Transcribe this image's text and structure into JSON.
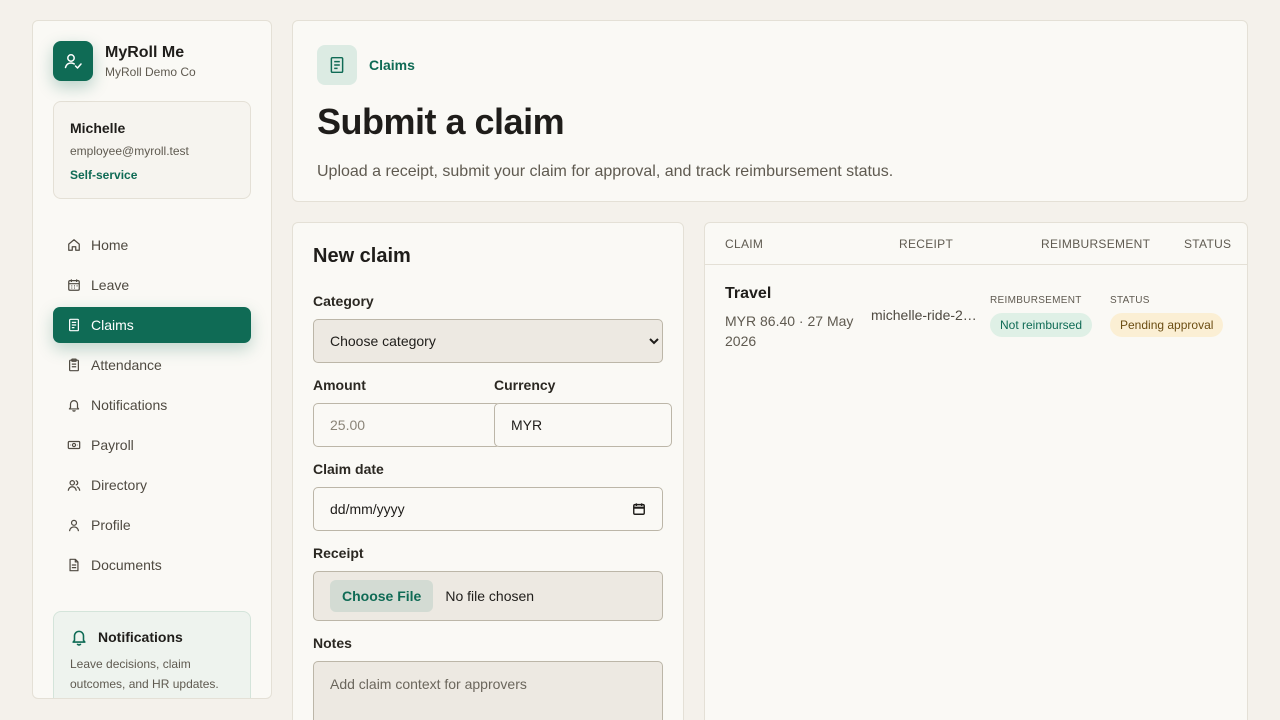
{
  "brand": {
    "name": "MyRoll Me",
    "org": "MyRoll Demo Co"
  },
  "user": {
    "name": "Michelle",
    "email": "employee@myroll.test",
    "role": "Self-service"
  },
  "nav": [
    {
      "label": "Home",
      "icon": "home-icon"
    },
    {
      "label": "Leave",
      "icon": "calendar-icon"
    },
    {
      "label": "Claims",
      "icon": "receipt-icon",
      "active": true
    },
    {
      "label": "Attendance",
      "icon": "clipboard-icon"
    },
    {
      "label": "Notifications",
      "icon": "bell-icon"
    },
    {
      "label": "Payroll",
      "icon": "cash-icon"
    },
    {
      "label": "Directory",
      "icon": "users-icon"
    },
    {
      "label": "Profile",
      "icon": "user-icon"
    },
    {
      "label": "Documents",
      "icon": "document-icon"
    }
  ],
  "notifications_card": {
    "title": "Notifications",
    "text": "Leave decisions, claim outcomes, and HR updates."
  },
  "header": {
    "crumb": "Claims",
    "title": "Submit a claim",
    "subtitle": "Upload a receipt, submit your claim for approval, and track reimbursement status."
  },
  "form": {
    "title": "New claim",
    "category_label": "Category",
    "category_value": "Choose category",
    "amount_label": "Amount",
    "amount_placeholder": "25.00",
    "currency_label": "Currency",
    "currency_value": "MYR",
    "date_label": "Claim date",
    "date_placeholder": "dd/mm/yyyy",
    "receipt_label": "Receipt",
    "file_button": "Choose File",
    "file_status": "No file chosen",
    "notes_label": "Notes",
    "notes_placeholder": "Add claim context for approvers"
  },
  "table": {
    "columns": [
      "CLAIM",
      "RECEIPT",
      "REIMBURSEMENT",
      "STATUS"
    ],
    "rows": [
      {
        "title": "Travel",
        "meta": "MYR 86.40 · 27 May 2026",
        "receipt": "michelle-ride-2…",
        "reimbursement_label": "REIMBURSEMENT",
        "reimbursement": "Not reimbursed",
        "status_label": "STATUS",
        "status": "Pending approval"
      }
    ]
  },
  "colors": {
    "accent": "#0f6b55",
    "background": "#f4f1eb",
    "card": "#faf9f5"
  }
}
